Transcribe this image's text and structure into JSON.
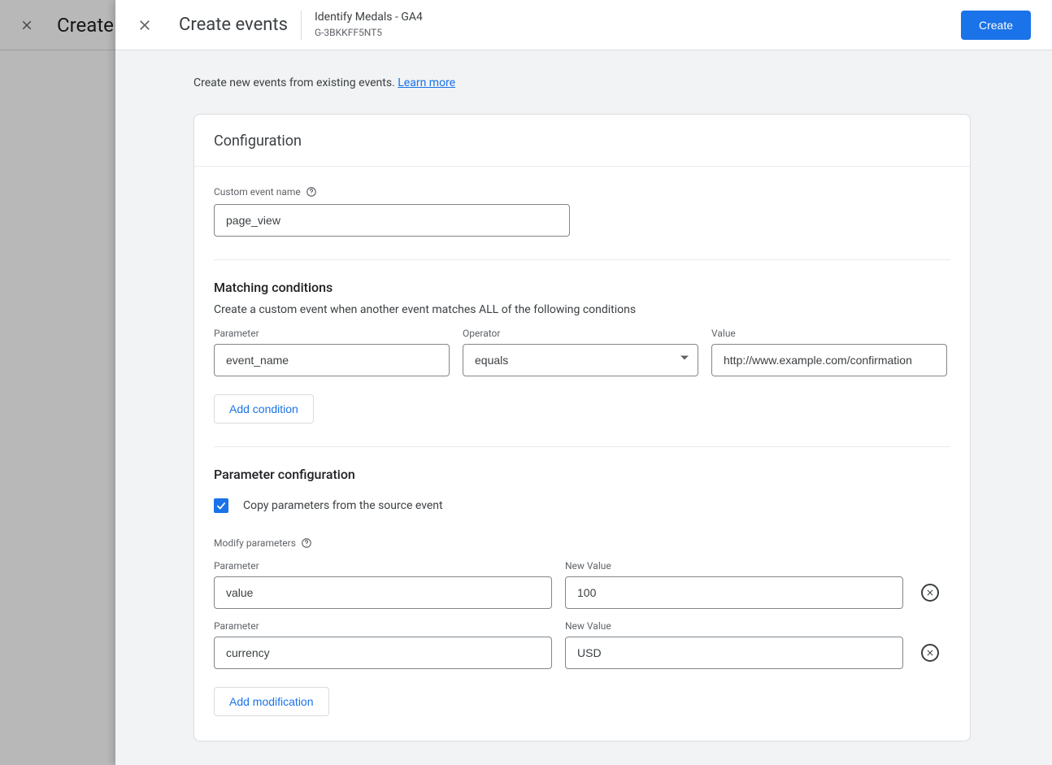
{
  "background": {
    "title": "Create"
  },
  "header": {
    "title": "Create events",
    "propertyName": "Identify Medals - GA4",
    "propertyId": "G-3BKKFF5NT5",
    "createButton": "Create"
  },
  "intro": {
    "text": "Create new events from existing events. ",
    "learnMore": "Learn more"
  },
  "config": {
    "title": "Configuration",
    "customEventLabel": "Custom event name",
    "customEventValue": "page_view"
  },
  "matching": {
    "title": "Matching conditions",
    "desc": "Create a custom event when another event matches ALL of the following conditions",
    "labels": {
      "parameter": "Parameter",
      "operator": "Operator",
      "value": "Value"
    },
    "row": {
      "parameter": "event_name",
      "operator": "equals",
      "value": "http://www.example.com/confirmation"
    },
    "addCondition": "Add condition"
  },
  "paramConfig": {
    "title": "Parameter configuration",
    "copyLabel": "Copy parameters from the source event",
    "copyChecked": true,
    "modifyLabel": "Modify parameters",
    "labels": {
      "parameter": "Parameter",
      "newValue": "New Value"
    },
    "rows": [
      {
        "parameter": "value",
        "newValue": "100"
      },
      {
        "parameter": "currency",
        "newValue": "USD"
      }
    ],
    "addModification": "Add modification"
  }
}
